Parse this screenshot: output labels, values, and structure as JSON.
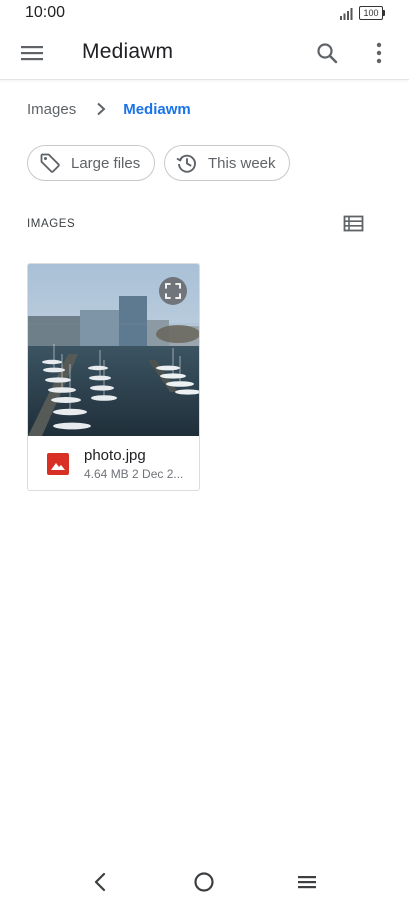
{
  "status_bar": {
    "time": "10:00",
    "battery": "100",
    "signal_icon": "signal-icon",
    "battery_icon": "battery-icon"
  },
  "app_bar": {
    "title": "Mediawm",
    "menu_icon": "hamburger-menu-icon",
    "search_icon": "search-icon",
    "more_icon": "more-vert-icon"
  },
  "breadcrumb": {
    "root": "Images",
    "current": "Mediawm",
    "separator_icon": "chevron-right-icon",
    "accent_color": "#1a73e8"
  },
  "filters": [
    {
      "label": "Large files",
      "icon": "tag-icon"
    },
    {
      "label": "This week",
      "icon": "history-icon"
    }
  ],
  "section": {
    "label": "IMAGES",
    "view_toggle_icon": "list-view-icon"
  },
  "files": [
    {
      "name": "photo.jpg",
      "meta": "4.64 MB  2 Dec 2...",
      "type_icon": "image-file-icon",
      "type_color": "#d93025",
      "expand_icon": "expand-icon"
    }
  ],
  "nav_bar": {
    "back_icon": "back-icon",
    "home_icon": "home-icon",
    "recents_icon": "menu-icon"
  }
}
